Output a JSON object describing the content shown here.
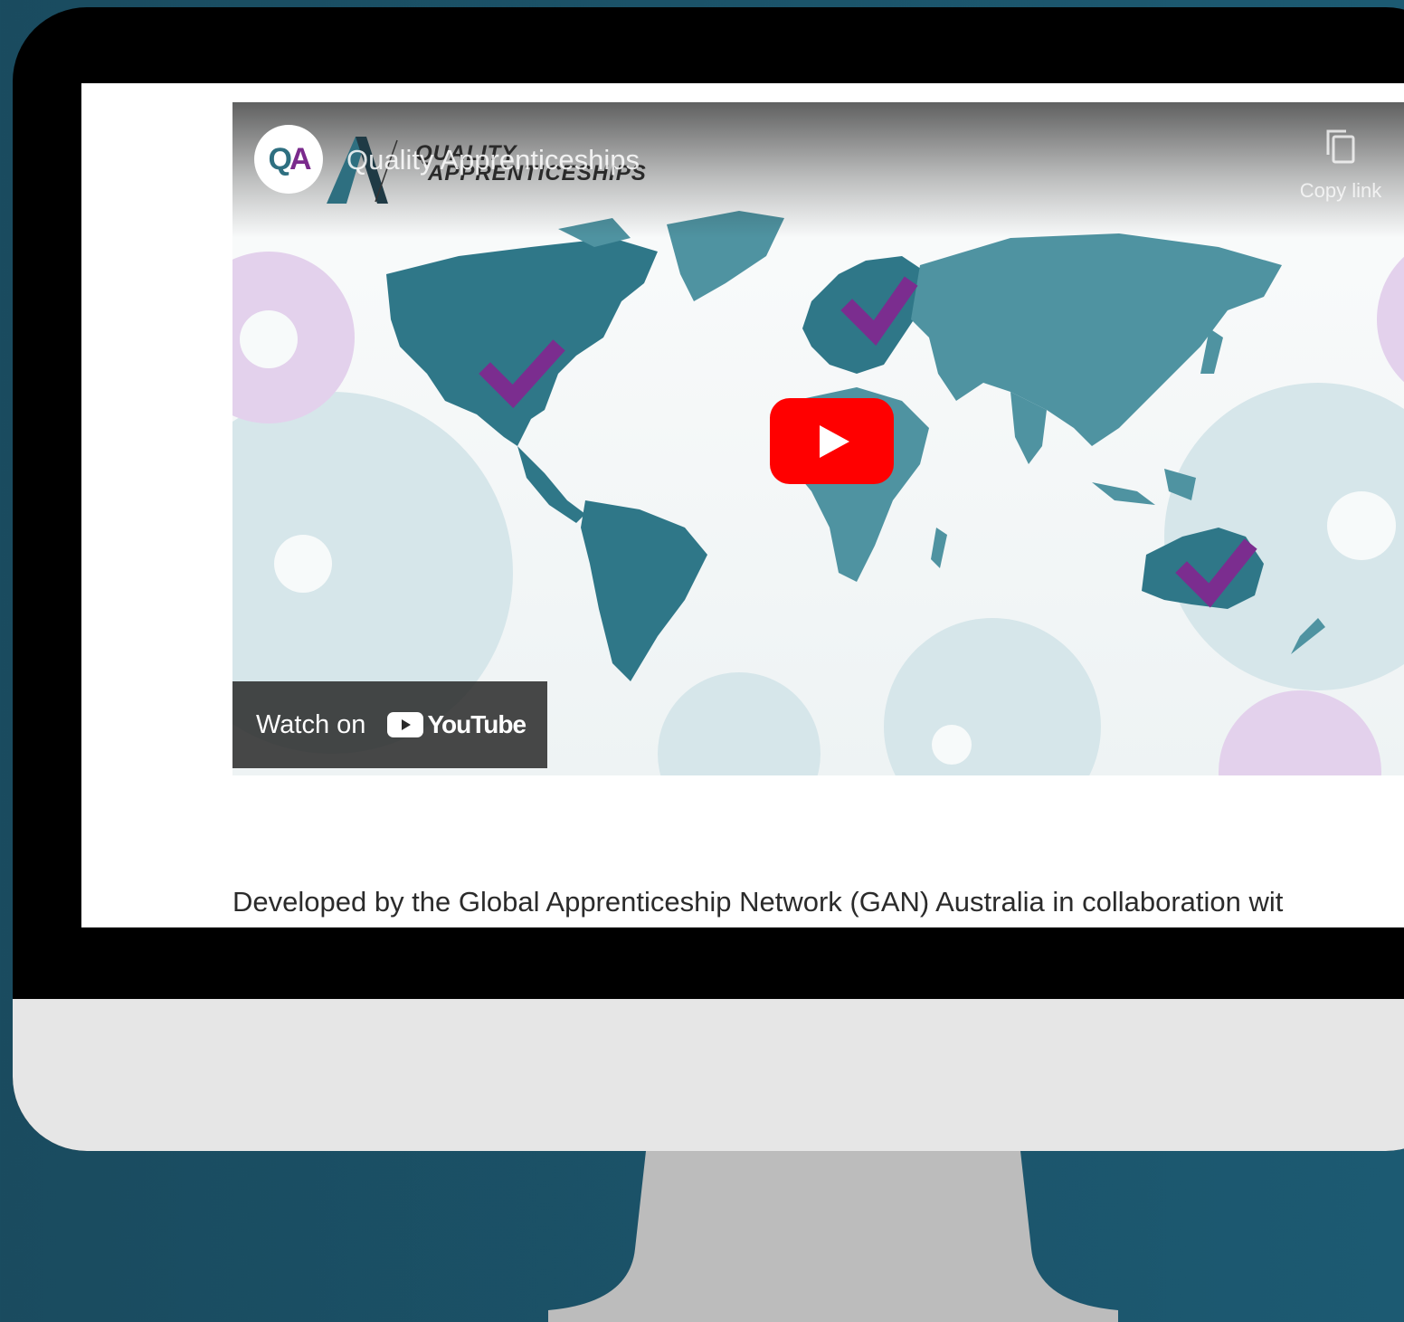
{
  "video": {
    "title": "Quality Apprenticeships",
    "channel_avatar": {
      "q": "Q",
      "a": "A"
    },
    "logo_words": [
      "QUALITY",
      "APPRENTICESHIPS"
    ],
    "copy_link_label": "Copy link",
    "watch_on_label": "Watch on",
    "youtube_label": "YouTube",
    "play_icon": "play-icon"
  },
  "page": {
    "caption": "Developed by the Global Apprenticeship Network (GAN) Australia in collaboration wit"
  },
  "colors": {
    "background": "#1b5268",
    "map_land": "#4f93a1",
    "map_highlight": "#2f7788",
    "checkmark": "#7b2d8f",
    "gear_purple": "#dcc6e6",
    "gear_blue": "#d6e6ea",
    "play_red": "#ff0000",
    "stand": "#bcbcbc",
    "chin": "#e6e6e6"
  }
}
